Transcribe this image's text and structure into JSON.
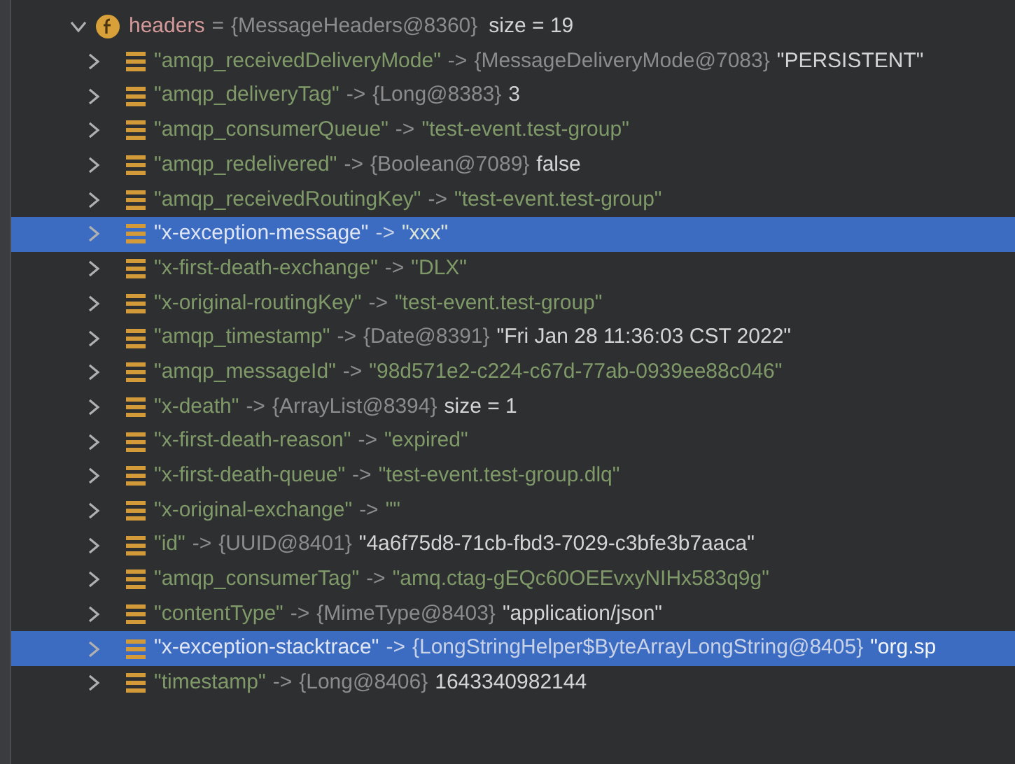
{
  "variable": {
    "name": "headers",
    "equals": "=",
    "ref": "{MessageHeaders@8360}",
    "extra": "size = 19",
    "expanded": true,
    "entries": [
      {
        "key": "\"amqp_receivedDeliveryMode\"",
        "arrow": "->",
        "ref": "{MessageDeliveryMode@7083}",
        "value": "\"PERSISTENT\"",
        "kind": "plain",
        "selected": false
      },
      {
        "key": "\"amqp_deliveryTag\"",
        "arrow": "->",
        "ref": "{Long@8383}",
        "value": "3",
        "kind": "plain",
        "selected": false
      },
      {
        "key": "\"amqp_consumerQueue\"",
        "arrow": "->",
        "value": "\"test-event.test-group\"",
        "kind": "string",
        "selected": false
      },
      {
        "key": "\"amqp_redelivered\"",
        "arrow": "->",
        "ref": "{Boolean@7089}",
        "value": "false",
        "kind": "plain",
        "selected": false
      },
      {
        "key": "\"amqp_receivedRoutingKey\"",
        "arrow": "->",
        "value": "\"test-event.test-group\"",
        "kind": "string",
        "selected": false
      },
      {
        "key": "\"x-exception-message\"",
        "arrow": "->",
        "value": "\"xxx\"",
        "kind": "string",
        "selected": true
      },
      {
        "key": "\"x-first-death-exchange\"",
        "arrow": "->",
        "value": "\"DLX\"",
        "kind": "string",
        "selected": false
      },
      {
        "key": "\"x-original-routingKey\"",
        "arrow": "->",
        "value": "\"test-event.test-group\"",
        "kind": "string",
        "selected": false
      },
      {
        "key": "\"amqp_timestamp\"",
        "arrow": "->",
        "ref": "{Date@8391}",
        "value": "\"Fri Jan 28 11:36:03 CST 2022\"",
        "kind": "plain",
        "selected": false
      },
      {
        "key": "\"amqp_messageId\"",
        "arrow": "->",
        "value": "\"98d571e2-c224-c67d-77ab-0939ee88c046\"",
        "kind": "string",
        "selected": false
      },
      {
        "key": "\"x-death\"",
        "arrow": "->",
        "ref": "{ArrayList@8394}",
        "value": "size = 1",
        "kind": "plain",
        "selected": false
      },
      {
        "key": "\"x-first-death-reason\"",
        "arrow": "->",
        "value": "\"expired\"",
        "kind": "string",
        "selected": false
      },
      {
        "key": "\"x-first-death-queue\"",
        "arrow": "->",
        "value": "\"test-event.test-group.dlq\"",
        "kind": "string",
        "selected": false
      },
      {
        "key": "\"x-original-exchange\"",
        "arrow": "->",
        "value": "\"\"",
        "kind": "string",
        "selected": false
      },
      {
        "key": "\"id\"",
        "arrow": "->",
        "ref": "{UUID@8401}",
        "value": "\"4a6f75d8-71cb-fbd3-7029-c3bfe3b7aaca\"",
        "kind": "plain",
        "selected": false
      },
      {
        "key": "\"amqp_consumerTag\"",
        "arrow": "->",
        "value": "\"amq.ctag-gEQc60OEEvxyNIHx583q9g\"",
        "kind": "string",
        "selected": false
      },
      {
        "key": "\"contentType\"",
        "arrow": "->",
        "ref": "{MimeType@8403}",
        "value": "\"application/json\"",
        "kind": "plain",
        "selected": false
      },
      {
        "key": "\"x-exception-stacktrace\"",
        "arrow": "->",
        "ref": "{LongStringHelper$ByteArrayLongString@8405}",
        "value": "\"org.sp",
        "kind": "plain",
        "selected": true
      },
      {
        "key": "\"timestamp\"",
        "arrow": "->",
        "ref": "{Long@8406}",
        "value": "1643340982144",
        "kind": "plain",
        "selected": false
      }
    ]
  }
}
